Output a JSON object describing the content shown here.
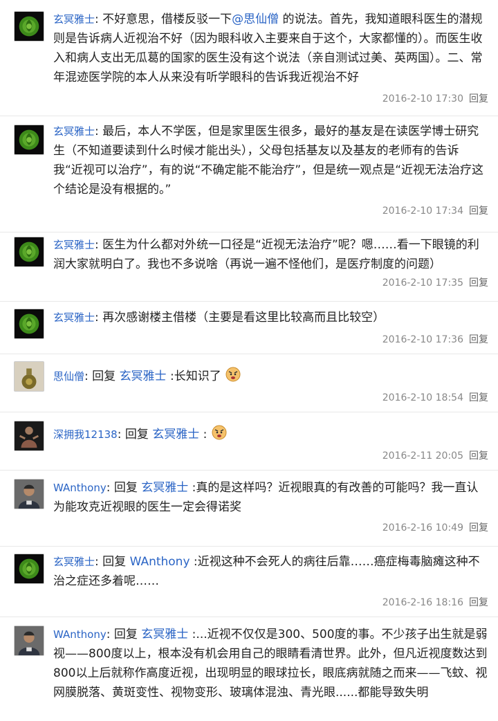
{
  "comments": [
    {
      "user": "玄冥雅士",
      "colon": ": ",
      "text_a": "不好意思，借楼反驳一下",
      "mention": "@思仙僧",
      "text_b": " 的说法。首先，我知道眼科医生的潜规则是告诉病人近视治不好（因为眼科收入主要来自于这个，大家都懂的）。而医生收入和病人支出无瓜葛的国家的医生没有这个说法（亲自测试过美、英两国）。二、常年混迹医学院的本人从来没有听学眼科的告诉我近视治不好",
      "time": "2016-2-10 17:30",
      "reply": "回复"
    },
    {
      "user": "玄冥雅士",
      "colon": ": ",
      "text": "最后，本人不学医，但是家里医生很多，最好的基友是在读医学博士研究生（不知道要读到什么时候才能出头），父母包括基友以及基友的老师有的告诉我“近视可以治疗”，有的说“不确定能不能治疗”，但是统一观点是“近视无法治疗这个结论是没有根据的。”",
      "time": "2016-2-10 17:34",
      "reply": "回复"
    },
    {
      "user": "玄冥雅士",
      "colon": ": ",
      "text": "医生为什么都对外统一口径是“近视无法治疗”呢？嗯……看一下眼镜的利润大家就明白了。我也不多说啥（再说一遍不怪他们，是医疗制度的问题）",
      "time": "2016-2-10 17:35",
      "reply": "回复"
    },
    {
      "user": "玄冥雅士",
      "colon": ": ",
      "text": "再次感谢楼主借楼（主要是看这里比较高而且比较空）",
      "time": "2016-2-10 17:36",
      "reply": "回复"
    },
    {
      "user": "思仙僧",
      "colon": ": ",
      "reply_kw": "回复",
      "reply_to": "玄冥雅士",
      "text": " :长知识了",
      "emoji": "emoji-face-icon",
      "time": "2016-2-10 18:54",
      "reply": "回复"
    },
    {
      "user": "深拥我12138",
      "colon": ": ",
      "reply_kw": "回复",
      "reply_to": "玄冥雅士",
      "text": " :",
      "emoji": "emoji-face-icon",
      "time": "2016-2-11 20:05",
      "reply": "回复"
    },
    {
      "user": "WAnthony",
      "colon": ": ",
      "reply_kw": "回复",
      "reply_to": "玄冥雅士",
      "text": " :真的是这样吗？近视眼真的有改善的可能吗？我一直认为能攻克近视眼的医生一定会得诺奖",
      "time": "2016-2-16 10:49",
      "reply": "回复"
    },
    {
      "user": "玄冥雅士",
      "colon": ": ",
      "reply_kw": "回复",
      "reply_to": "WAnthony",
      "text": " :近视这种不会死人的病往后靠……癌症梅毒脑瘫这种不治之症还多着呢……",
      "time": "2016-2-16 18:16",
      "reply": "回复"
    },
    {
      "user": "WAnthony",
      "colon": ": ",
      "reply_kw": "回复",
      "reply_to": "玄冥雅士",
      "text": " :...近视不仅仅是300、500度的事。不少孩子出生就是弱视——800度以上，根本没有机会用自己的眼睛看清世界。此外，但凡近视度数达到800以上后就称作高度近视，出现明显的眼球拉长，眼底病就随之而来——飞蚊、视网膜脱落、黄斑变性、视物变形、玻璃体混浊、青光眼......都能导致失明"
    }
  ],
  "colors": {
    "link": "#2a64c5",
    "meta": "#888888",
    "rose": "#3d8a1a"
  }
}
